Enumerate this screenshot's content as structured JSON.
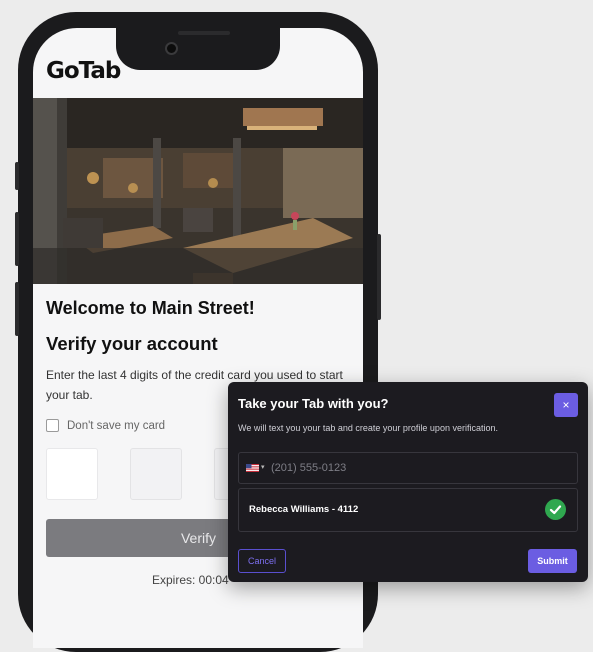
{
  "app": {
    "logo_text": "GoTab"
  },
  "page": {
    "welcome": "Welcome to Main Street!",
    "verify_title": "Verify your account",
    "instructions": "Enter the last 4 digits of the credit card you used to start your tab.",
    "save_card_label": "Don't save my card",
    "verify_button": "Verify",
    "expires": "Expires: 00:04"
  },
  "modal": {
    "title": "Take your Tab with you?",
    "close_symbol": "×",
    "description": "We will text you your tab and create your profile upon verification.",
    "phone_placeholder": "(201) 555-0123",
    "card_holder": "Rebecca Williams - 4112",
    "cancel_label": "Cancel",
    "submit_label": "Submit"
  },
  "icons": {
    "flag": "us-flag-icon",
    "check": "check-circle-icon",
    "close": "close-icon"
  },
  "colors": {
    "accent": "#6b5de2",
    "success": "#2fa84f",
    "modal_bg": "#1c1b20",
    "verify_button": "#7b7b7f"
  }
}
